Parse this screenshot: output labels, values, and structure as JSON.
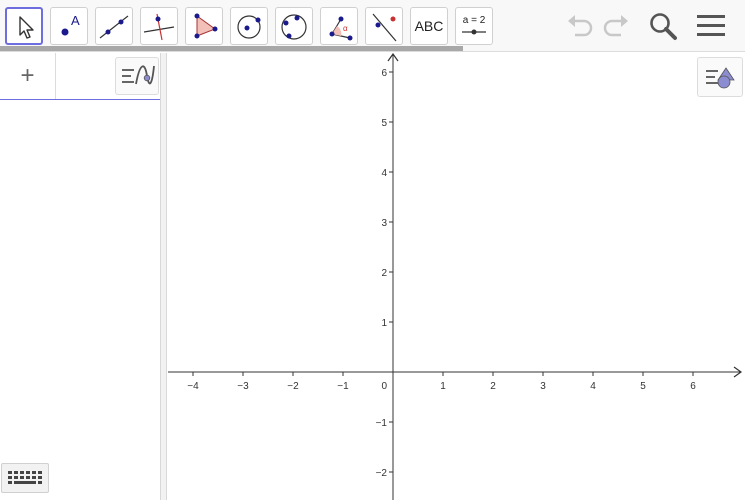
{
  "toolbar": {
    "tools": [
      {
        "name": "move-tool",
        "label": ""
      },
      {
        "name": "point-tool",
        "label": "A"
      },
      {
        "name": "line-tool",
        "label": ""
      },
      {
        "name": "perpendicular-line-tool",
        "label": ""
      },
      {
        "name": "polygon-tool",
        "label": ""
      },
      {
        "name": "circle-center-point-tool",
        "label": ""
      },
      {
        "name": "circle-three-points-tool",
        "label": ""
      },
      {
        "name": "angle-tool",
        "label": "α"
      },
      {
        "name": "reflect-about-line-tool",
        "label": ""
      },
      {
        "name": "text-tool",
        "label": "ABC"
      },
      {
        "name": "slider-tool",
        "label": "a = 2"
      }
    ],
    "right_icons": [
      "undo-icon",
      "redo-icon",
      "search-icon",
      "menu-icon"
    ]
  },
  "algebra": {
    "add_label": "+",
    "input_value": ""
  },
  "graphics": {
    "x_ticks": [
      "−4",
      "−3",
      "−2",
      "−1",
      "1",
      "2",
      "3",
      "4",
      "5",
      "6"
    ],
    "y_ticks": [
      "6",
      "5",
      "4",
      "3",
      "2",
      "1",
      "−1",
      "−2"
    ],
    "origin_label": "0"
  },
  "colors": {
    "accent": "#6d6de0",
    "point": "#1a1a8c",
    "polygon_fill": "#f2c0b8",
    "axis": "#333333"
  }
}
